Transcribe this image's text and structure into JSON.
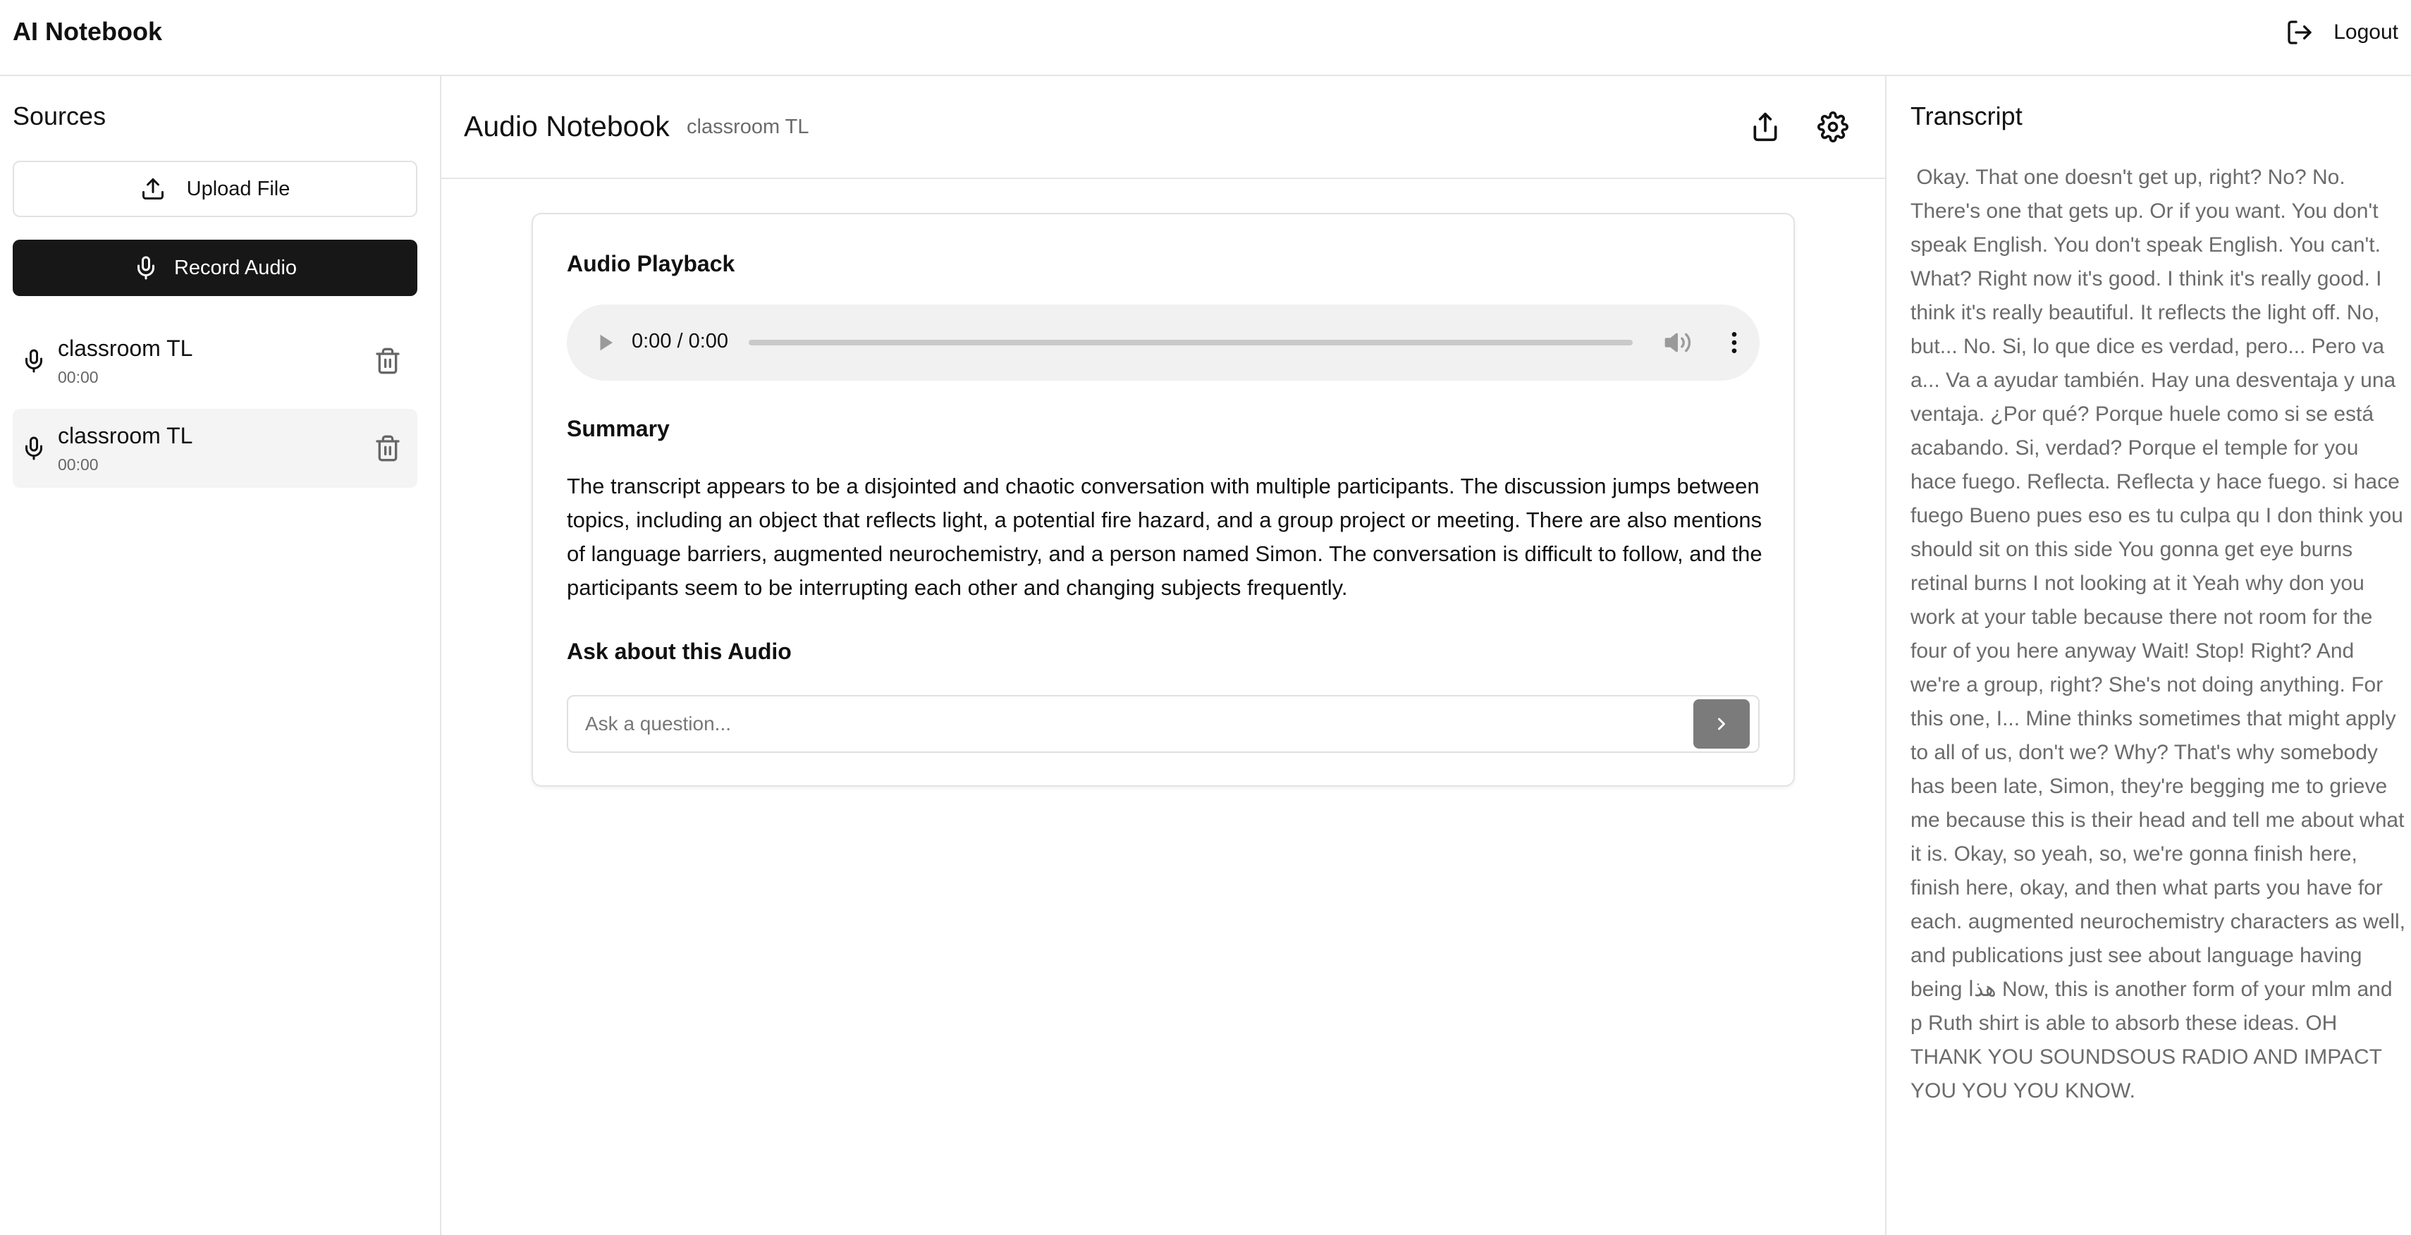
{
  "app": {
    "title": "AI Notebook",
    "logout_label": "Logout"
  },
  "sidebar": {
    "title": "Sources",
    "upload_label": "Upload File",
    "record_label": "Record Audio",
    "items": [
      {
        "name": "classroom TL",
        "duration": "00:00"
      },
      {
        "name": "classroom TL",
        "duration": "00:00"
      }
    ]
  },
  "main": {
    "title": "Audio Notebook",
    "subtitle": "classroom TL",
    "playback_title": "Audio Playback",
    "player": {
      "time": "0:00 / 0:00",
      "progress": 0
    },
    "summary_title": "Summary",
    "summary_text": "The transcript appears to be a disjointed and chaotic conversation with multiple participants. The discussion jumps between topics, including an object that reflects light, a potential fire hazard, and a group project or meeting. There are also mentions of language barriers, augmented neurochemistry, and a person named Simon. The conversation is difficult to follow, and the participants seem to be interrupting each other and changing subjects frequently.",
    "ask_title": "Ask about this Audio",
    "ask_placeholder": "Ask a question..."
  },
  "transcript": {
    "title": "Transcript",
    "text": " Okay. That one doesn't get up, right? No? No. There's one that gets up. Or if you want. You don't speak English. You don't speak English. You can't. What? Right now it's good. I think it's really good. I think it's really beautiful. It reflects the light off. No, but... No. Si, lo que dice es verdad, pero... Pero va a... Va a ayudar también. Hay una desventaja y una ventaja. ¿Por qué? Porque huele como si se está acabando. Si, verdad? Porque el temple for you hace fuego. Reflecta. Reflecta y hace fuego. si hace fuego Bueno pues eso es tu culpa qu I don think you should sit on this side You gonna get eye burns retinal burns I not looking at it Yeah why don you work at your table because there not room for the four of you here anyway Wait! Stop! Right? And we're a group, right? She's not doing anything. For this one, I... Mine thinks sometimes that might apply to all of us, don't we? Why? That's why somebody has been late, Simon, they're begging me to grieve me because this is their head and tell me about what it is. Okay, so yeah, so, we're gonna finish here, finish here, okay, and then what parts you have for each. augmented neurochemistry characters as well, and publications just see about language having being هذا Now, this is another form of your mlm and p Ruth shirt is able to absorb these ideas. OH THANK YOU SOUNDSOUS RADIO AND IMPACT YOU YOU YOU KNOW."
  },
  "colors": {
    "accent_dark": "#171717",
    "send_button": "#7b7b7b",
    "selected_item_bg": "#f4f4f4",
    "muted_text": "#6b6b6b"
  },
  "icons": {
    "logout": "logout-icon",
    "upload": "upload-icon",
    "record": "microphone-icon",
    "source": "microphone-icon",
    "delete": "trash-icon",
    "share": "share-icon",
    "settings": "gear-icon",
    "play": "play-icon",
    "volume": "volume-icon",
    "more": "more-vertical-icon",
    "send": "chevron-right-icon"
  }
}
